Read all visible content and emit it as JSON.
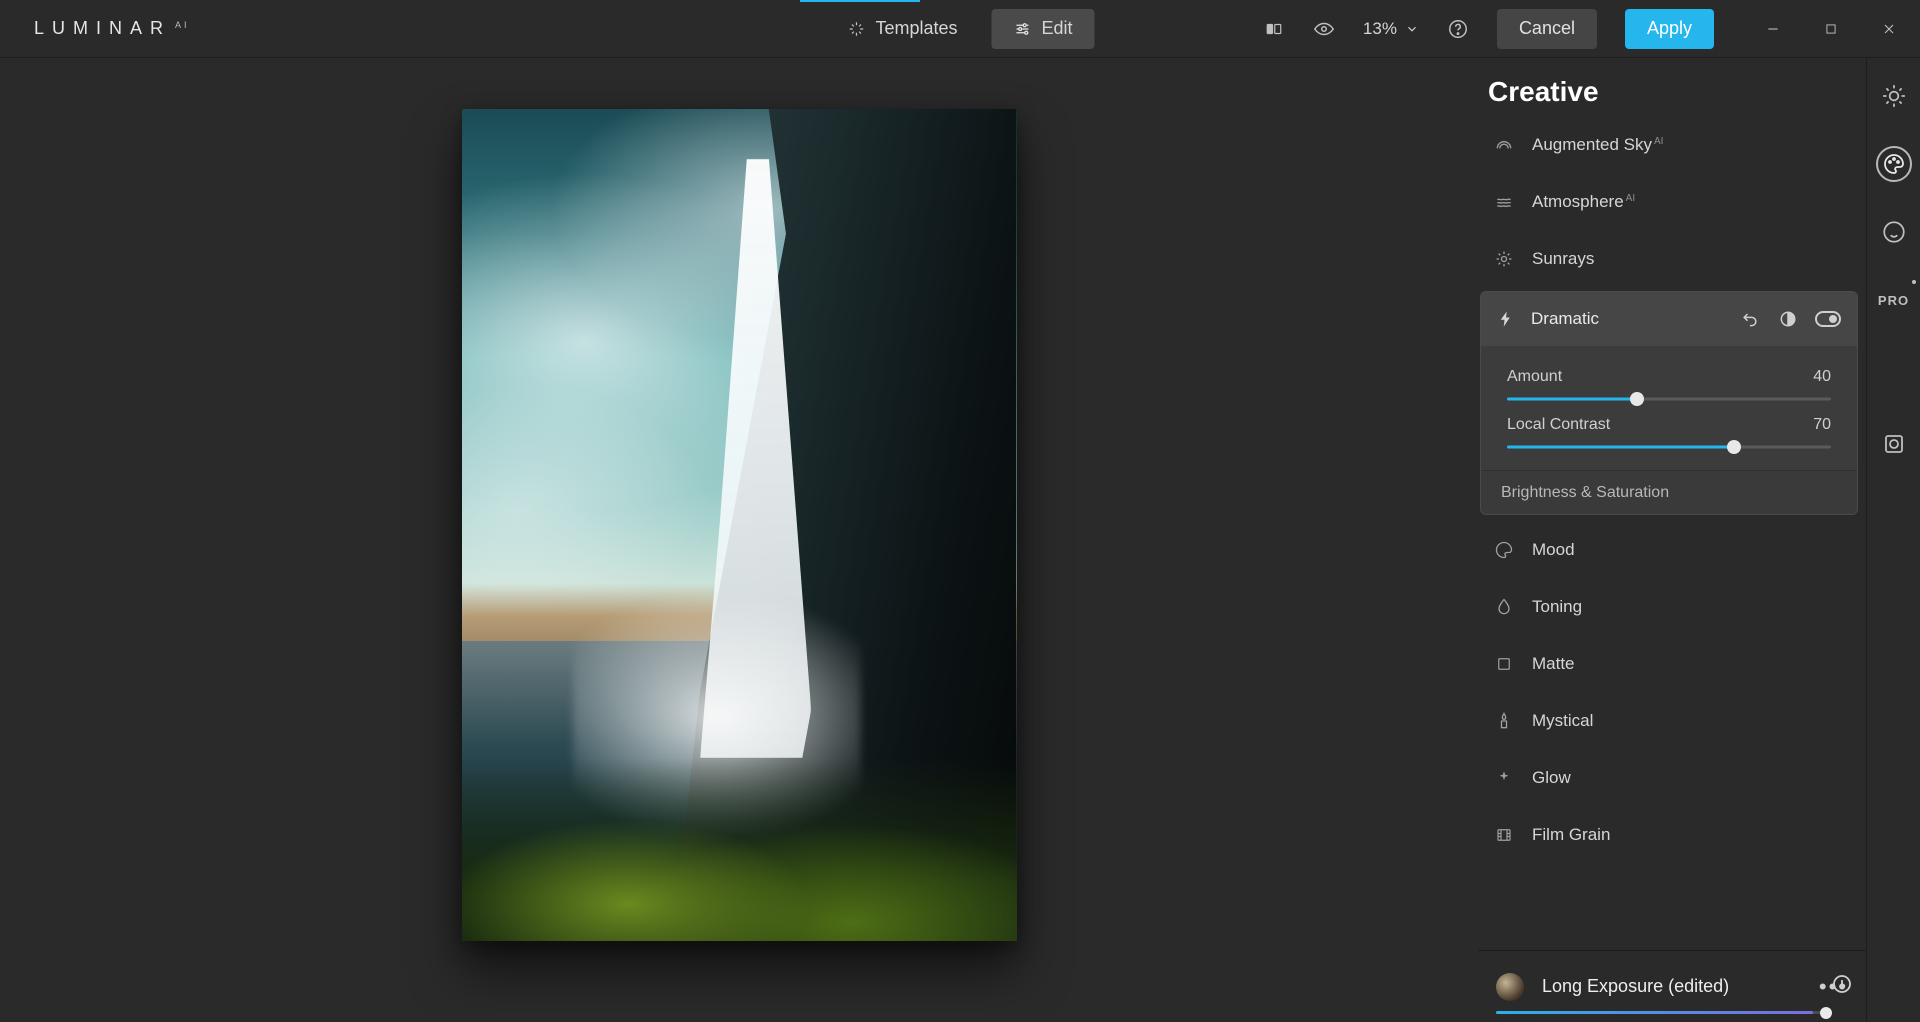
{
  "brand": {
    "name": "LUMINAR",
    "superscript": "AI"
  },
  "topbar": {
    "tabs": {
      "templates": "Templates",
      "edit": "Edit"
    },
    "zoom": "13%",
    "buttons": {
      "cancel": "Cancel",
      "apply": "Apply"
    }
  },
  "panel": {
    "title": "Creative",
    "tools": {
      "augmented_sky": {
        "label": "Augmented Sky",
        "ai": "AI"
      },
      "atmosphere": {
        "label": "Atmosphere",
        "ai": "AI"
      },
      "sunrays": {
        "label": "Sunrays"
      },
      "dramatic": {
        "label": "Dramatic",
        "sliders": {
          "amount": {
            "label": "Amount",
            "value": "40",
            "percent": 40
          },
          "local_contrast": {
            "label": "Local Contrast",
            "value": "70",
            "percent": 70
          }
        },
        "subsection": "Brightness & Saturation"
      },
      "mood": {
        "label": "Mood"
      },
      "toning": {
        "label": "Toning"
      },
      "matte": {
        "label": "Matte"
      },
      "mystical": {
        "label": "Mystical"
      },
      "glow": {
        "label": "Glow"
      },
      "film_grain": {
        "label": "Film Grain"
      }
    }
  },
  "preset": {
    "name": "Long Exposure (edited)"
  },
  "rail": {
    "pro_label": "PRO"
  }
}
